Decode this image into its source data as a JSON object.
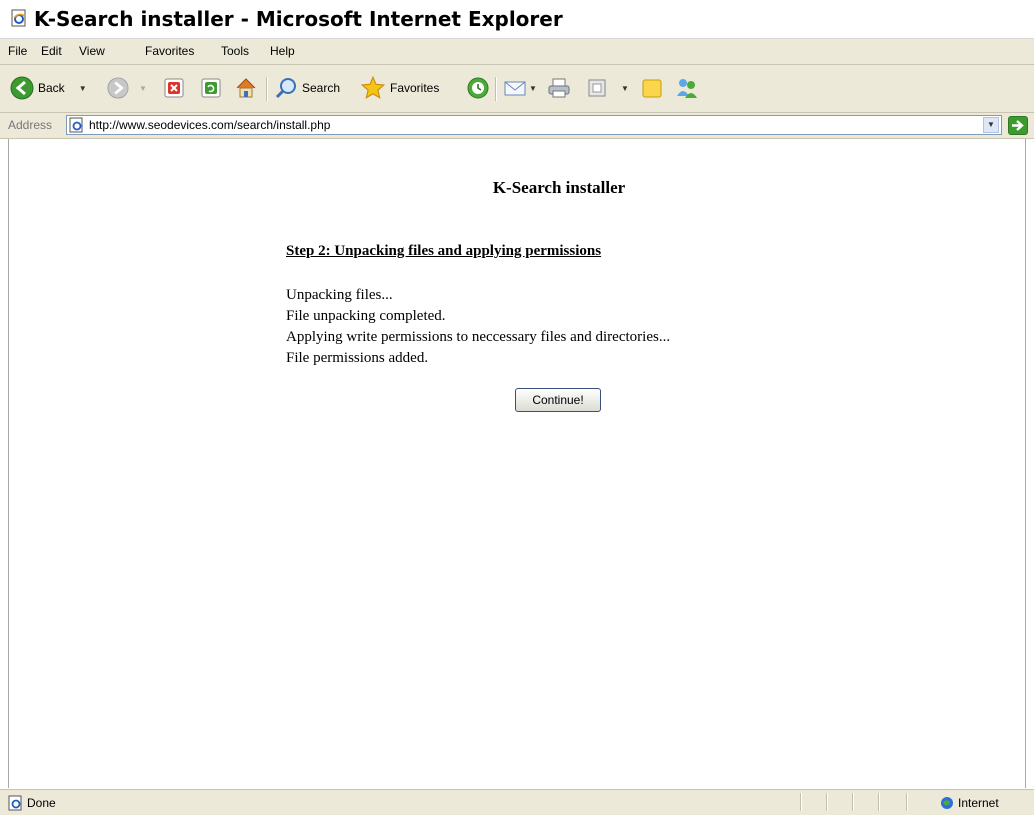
{
  "window": {
    "title": "K-Search installer - Microsoft Internet Explorer"
  },
  "menu": {
    "items": [
      "File",
      "Edit",
      "View",
      "Favorites",
      "Tools",
      "Help"
    ]
  },
  "toolbar": {
    "back_label": "Back",
    "search_label": "Search",
    "favorites_label": "Favorites"
  },
  "address": {
    "label": "Address",
    "url": "http://www.seodevices.com/search/install.php"
  },
  "page": {
    "title": "K-Search installer",
    "step_heading": "Step 2: Unpacking files and applying permissions",
    "log": [
      "Unpacking files...",
      "File unpacking completed.",
      "Applying write permissions to neccessary files and directories...",
      "File permissions added."
    ],
    "continue_label": "Continue!"
  },
  "status": {
    "text": "Done",
    "zone": "Internet"
  },
  "icons": {
    "title": "ie-page-icon",
    "back": "back-arrow-icon",
    "forward": "forward-arrow-icon",
    "stop": "stop-icon",
    "refresh": "refresh-icon",
    "home": "home-icon",
    "search": "magnifier-icon",
    "favorites": "star-icon",
    "history": "history-icon",
    "mail": "mail-icon",
    "print": "printer-icon",
    "edit": "edit-icon",
    "discuss": "discuss-icon",
    "messenger": "messenger-icon",
    "go": "go-arrow-icon",
    "zone": "globe-icon"
  },
  "colors": {
    "chrome": "#ece9d8",
    "back_green": "#3c9a2e",
    "link_blue": "#0a3f9f"
  }
}
